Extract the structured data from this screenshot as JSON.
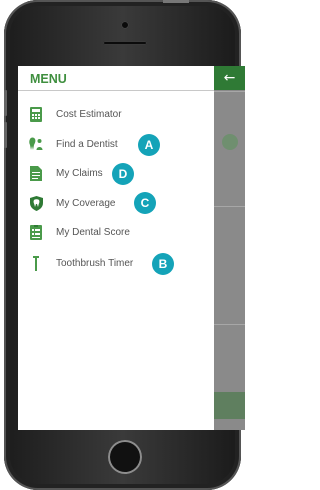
{
  "menu": {
    "title": "MENU",
    "items": [
      {
        "label": "Cost Estimator",
        "icon": "calculator-icon"
      },
      {
        "label": "Find a Dentist",
        "icon": "tooth-person-icon"
      },
      {
        "label": "My Claims",
        "icon": "document-icon"
      },
      {
        "label": "My Coverage",
        "icon": "shield-icon"
      },
      {
        "label": "My Dental Score",
        "icon": "scorecard-icon"
      },
      {
        "label": "Toothbrush Timer",
        "icon": "toothbrush-icon"
      }
    ]
  },
  "badges": {
    "a": "A",
    "b": "B",
    "c": "C",
    "d": "D"
  },
  "back_arrow": "←",
  "colors": {
    "accent_green": "#3f8f3f",
    "badge_teal": "#14a3b8"
  }
}
